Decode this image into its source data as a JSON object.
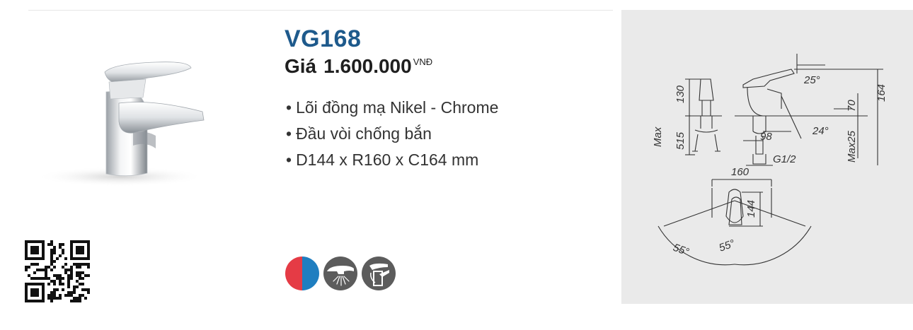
{
  "product": {
    "model": "VG168",
    "price_label": "Giá",
    "price_value": "1.600.000",
    "price_currency": "VNĐ",
    "features": [
      "Lõi đồng mạ Nikel - Chrome",
      "Đầu vòi chống bắn",
      "D144 x R160 x C164 mm"
    ]
  },
  "feature_icons": [
    "hot-cold-icon",
    "aerator-spray-icon",
    "lever-handle-icon"
  ],
  "colors": {
    "model": "#1e5a8c",
    "hot": "#e53b45",
    "cold": "#1f7ec0",
    "icon_bg": "#5c5c5c",
    "panel": "#eaeaea"
  },
  "drawing": {
    "dims": {
      "d25deg": "25°",
      "d164": "164",
      "d130": "130",
      "d70": "70",
      "d515": "515",
      "max": "Max",
      "d98": "98",
      "d24deg": "24°",
      "max25": "Max25",
      "g12": "G1/2",
      "d160": "160",
      "d144": "144",
      "d55a": "55°",
      "d55b": "55°"
    }
  }
}
